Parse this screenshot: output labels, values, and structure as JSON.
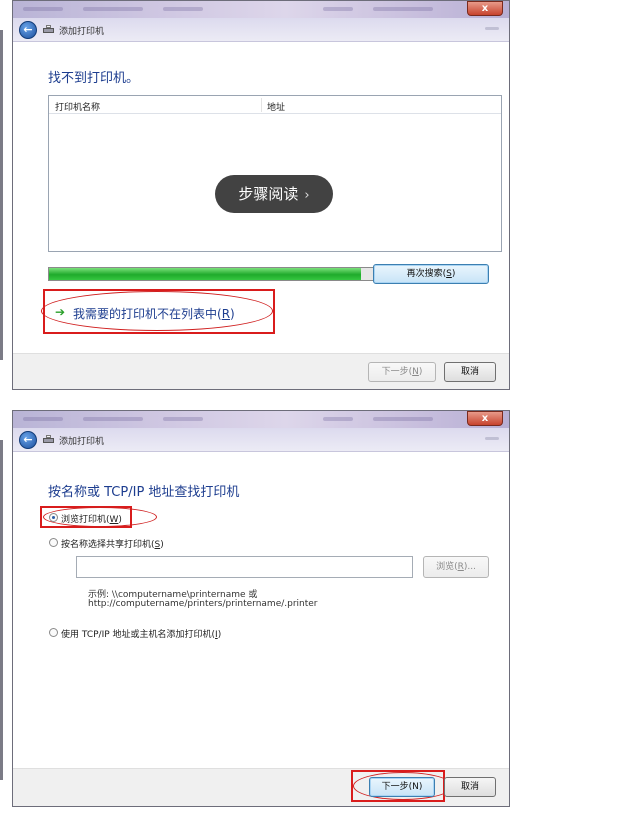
{
  "colors": {
    "accent": "#1d3d8f",
    "highlight": "#d91c1c",
    "progress": "#1faa2b"
  },
  "icons": {
    "close": "close-icon",
    "back": "back-arrow-icon",
    "printer": "printer-icon",
    "arrow": "green-arrow-icon",
    "chevron": "chevron-right-icon"
  },
  "window1": {
    "close_label": "x",
    "nav_title": "添加打印机",
    "heading": "找不到打印机。",
    "columns": [
      "打印机名称",
      "地址"
    ],
    "overlay_label": "步骤阅读",
    "overlay_chevron": "›",
    "progress_fraction": 0.95,
    "search_again_label": "再次搜索(",
    "search_again_key": "S",
    "link_label": "我需要的打印机不在列表中(",
    "link_key": "R",
    "next_label": "下一步(",
    "next_key": "N",
    "cancel_label": "取消",
    "paren_close": ")"
  },
  "window2": {
    "close_label": "x",
    "nav_title": "添加打印机",
    "heading": "按名称或 TCP/IP 地址查找打印机",
    "option1_label": "浏览打印机(",
    "option1_key": "W",
    "option2_label": "按名称选择共享打印机(",
    "option2_key": "S",
    "share_input_value": "",
    "browse_label": "浏览(",
    "browse_key": "R",
    "browse_suffix": ")...",
    "example_line1": "示例: \\\\computername\\printername 或",
    "example_line2": "http://computername/printers/printername/.printer",
    "option3_label": "使用 TCP/IP 地址或主机名添加打印机(",
    "option3_key": "I",
    "next_label": "下一步(N)",
    "cancel_label": "取消",
    "paren_close": ")"
  }
}
